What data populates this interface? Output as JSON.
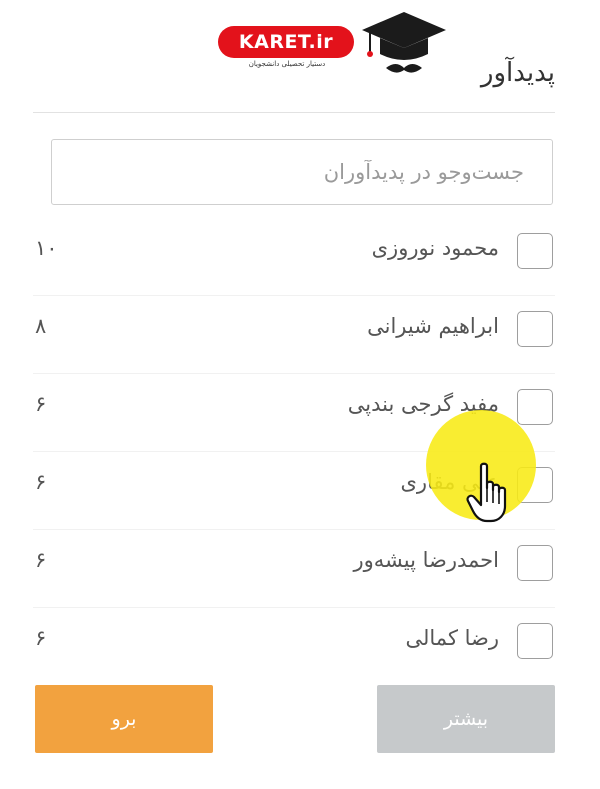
{
  "logo": {
    "brand": "KARET.ir",
    "tagline": "دستیار تحصیلی دانشجویان",
    "cap_icon": "graduation-cap-icon"
  },
  "filter": {
    "title": "پدیدآور",
    "search_placeholder": "جست‌وجو در پدیدآوران",
    "items": [
      {
        "label": "محمود نوروزی",
        "count": "۱۰",
        "checked": false
      },
      {
        "label": "ابراهیم شیرانی",
        "count": "۸",
        "checked": false
      },
      {
        "label": "مفید گرجی بندپی",
        "count": "۶",
        "checked": false
      },
      {
        "label": "علی مقاری",
        "count": "۶",
        "checked": false
      },
      {
        "label": "احمدرضا پیشه‌ور",
        "count": "۶",
        "checked": false
      },
      {
        "label": "رضا کمالی",
        "count": "۶",
        "checked": false
      }
    ],
    "more_label": "بیشتر",
    "go_label": "برو"
  },
  "colors": {
    "go_button": "#f2a23f",
    "more_button": "#c6c9cb",
    "brand_red": "#e3121b",
    "cursor_highlight": "#f8eb14"
  }
}
